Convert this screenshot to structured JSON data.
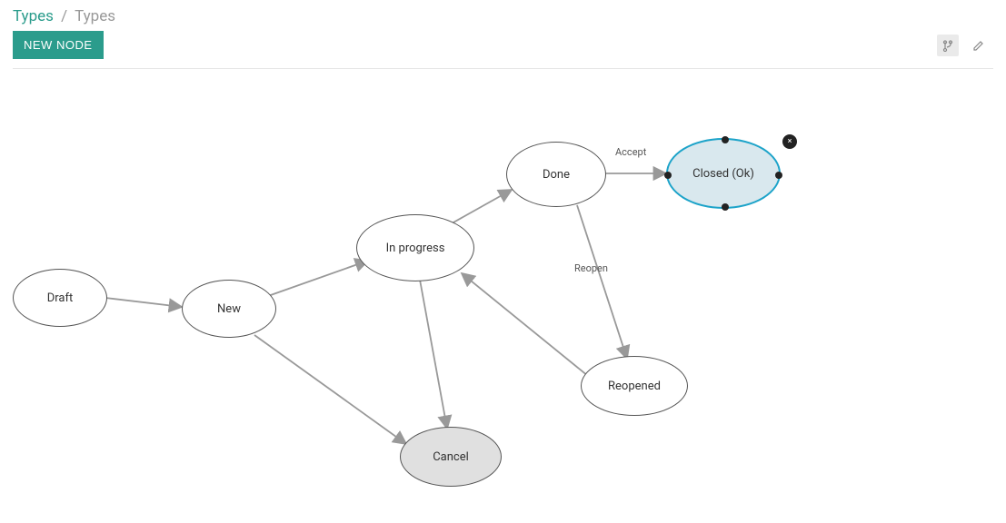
{
  "breadcrumb": {
    "root": "Types",
    "current": "Types"
  },
  "toolbar": {
    "newNode": "NEW NODE"
  },
  "nodes": {
    "draft": {
      "label": "Draft"
    },
    "new": {
      "label": "New"
    },
    "inprogress": {
      "label": "In progress"
    },
    "done": {
      "label": "Done"
    },
    "closedOk": {
      "label": "Closed (Ok)"
    },
    "reopened": {
      "label": "Reopened"
    },
    "cancel": {
      "label": "Cancel"
    }
  },
  "edges": {
    "accept": {
      "label": "Accept"
    },
    "reopen": {
      "label": "Reopen"
    }
  },
  "colors": {
    "accent": "#2b9c8c",
    "selectedStroke": "#1ca3c9",
    "selectedFill": "#d9e8ee",
    "nodeFill": "#e0e0e0",
    "arrow": "#888"
  }
}
